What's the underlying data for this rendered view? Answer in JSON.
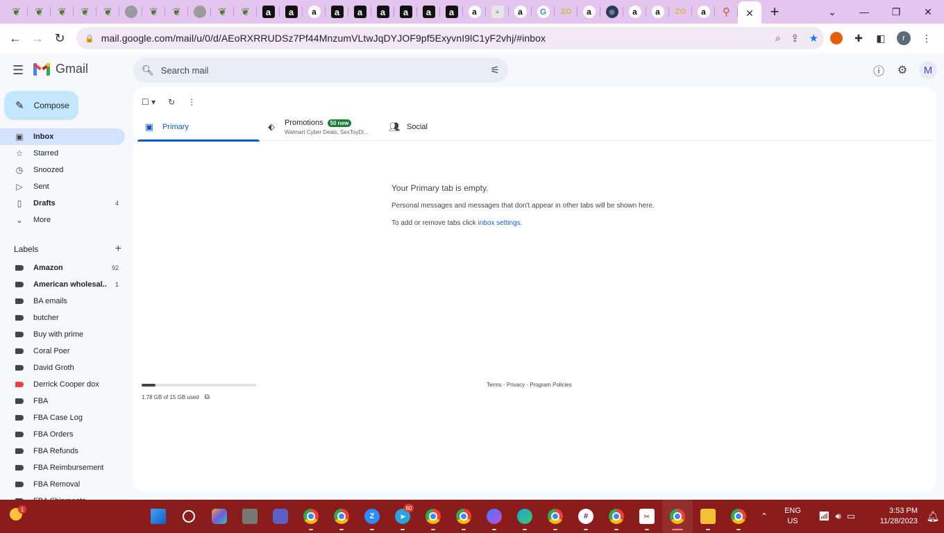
{
  "browser": {
    "tab_favicons": [
      "leaf",
      "leaf",
      "leaf",
      "leaf",
      "leaf",
      "globe",
      "leaf",
      "leaf",
      "globe",
      "leaf",
      "leaf",
      "amazon-a",
      "amazon-a",
      "amazon-smile",
      "amazon-a",
      "amazon-a",
      "amazon-a",
      "amazon-a",
      "amazon-a",
      "amazon-a",
      "amazon-smile",
      "tile",
      "amazon-smile",
      "google",
      "zo",
      "amazon-smile",
      "globe-dark",
      "amazon-smile",
      "amazon-smile",
      "zo",
      "amazon-smile",
      "maps"
    ],
    "active_tab_close": "✕",
    "new_tab": "+",
    "url": "mail.google.com/mail/u/0/d/AEoRXRRUDSz7Pf44MnzumVLtwJqDYJOF9pf5ExyvnI9lC1yF2vhj/#inbox",
    "profile_initial": "r"
  },
  "gmail": {
    "app_name": "Gmail",
    "search_placeholder": "Search mail",
    "account_initial": "M",
    "compose_label": "Compose",
    "nav": [
      {
        "label": "Inbox",
        "icon": "inbox-icon",
        "glyph": "▣",
        "count": "",
        "active": true,
        "bold": true
      },
      {
        "label": "Starred",
        "icon": "star-icon",
        "glyph": "☆",
        "count": "",
        "active": false,
        "bold": false
      },
      {
        "label": "Snoozed",
        "icon": "clock-icon",
        "glyph": "◷",
        "count": "",
        "active": false,
        "bold": false
      },
      {
        "label": "Sent",
        "icon": "send-icon",
        "glyph": "▷",
        "count": "",
        "active": false,
        "bold": false
      },
      {
        "label": "Drafts",
        "icon": "draft-icon",
        "glyph": "▯",
        "count": "4",
        "active": false,
        "bold": true
      },
      {
        "label": "More",
        "icon": "chevron-down-icon",
        "glyph": "⌄",
        "count": "",
        "active": false,
        "bold": false
      }
    ],
    "labels_title": "Labels",
    "labels": [
      {
        "name": "Amazon",
        "count": "92",
        "bold": true,
        "color": "#444444"
      },
      {
        "name": "American wholesal...",
        "count": "1",
        "bold": true,
        "color": "#444444"
      },
      {
        "name": "BA emails",
        "count": "",
        "bold": false,
        "color": "#444444"
      },
      {
        "name": "butcher",
        "count": "",
        "bold": false,
        "color": "#444444"
      },
      {
        "name": "Buy with prime",
        "count": "",
        "bold": false,
        "color": "#444444"
      },
      {
        "name": "Coral Poer",
        "count": "",
        "bold": false,
        "color": "#444444"
      },
      {
        "name": "David Groth",
        "count": "",
        "bold": false,
        "color": "#444444"
      },
      {
        "name": "Derrick Cooper dox",
        "count": "",
        "bold": false,
        "color": "#e8453c"
      },
      {
        "name": "FBA",
        "count": "",
        "bold": false,
        "color": "#444444"
      },
      {
        "name": "FBA Case Log",
        "count": "",
        "bold": false,
        "color": "#444444"
      },
      {
        "name": "FBA Orders",
        "count": "",
        "bold": false,
        "color": "#444444"
      },
      {
        "name": "FBA Refunds",
        "count": "",
        "bold": false,
        "color": "#444444"
      },
      {
        "name": "FBA Reimbursement",
        "count": "",
        "bold": false,
        "color": "#444444"
      },
      {
        "name": "FBA Removal",
        "count": "",
        "bold": false,
        "color": "#444444"
      },
      {
        "name": "FBA Shipments",
        "count": "",
        "bold": false,
        "color": "#444444"
      }
    ],
    "tabs": {
      "primary": "Primary",
      "promotions": "Promotions",
      "promotions_badge": "50 new",
      "promotions_sub": "Walmart Cyber Deals, SexToyDi...",
      "social": "Social"
    },
    "empty": {
      "title": "Your Primary tab is empty.",
      "desc": "Personal messages and messages that don't appear in other tabs will be shown here.",
      "hint_prefix": "To add or remove tabs click ",
      "hint_link": "inbox settings",
      "hint_suffix": "."
    },
    "storage": {
      "text": "1.78 GB of 15 GB used",
      "used_fraction": 0.119
    },
    "footer": "Terms · Privacy · Program Policies",
    "accent_color": "#0b57d0"
  },
  "taskbar": {
    "weather_badge": "1",
    "apps": [
      {
        "name": "start-button",
        "cls": "tb-win",
        "text": "",
        "badge": ""
      },
      {
        "name": "search-button",
        "cls": "tb-search",
        "text": "",
        "badge": ""
      },
      {
        "name": "copilot-app",
        "cls": "tb-copilot",
        "text": "",
        "badge": ""
      },
      {
        "name": "task-view-app",
        "cls": "tb-gray",
        "text": "",
        "badge": ""
      },
      {
        "name": "teams-app",
        "cls": "tb-teams",
        "text": "",
        "badge": ""
      },
      {
        "name": "chrome-app-a",
        "cls": "tb-chrome",
        "text": "",
        "badge": ""
      },
      {
        "name": "chrome-app-b",
        "cls": "tb-chrome",
        "text": "",
        "badge": ""
      },
      {
        "name": "zoom-app",
        "cls": "tb-zoom",
        "text": "Z",
        "badge": ""
      },
      {
        "name": "telegram-app",
        "cls": "tb-tele",
        "text": "➤",
        "badge": "60"
      },
      {
        "name": "chrome-app-c",
        "cls": "tb-chrome",
        "text": "",
        "badge": ""
      },
      {
        "name": "chrome-app-d",
        "cls": "tb-chrome",
        "text": "",
        "badge": ""
      },
      {
        "name": "messenger-app",
        "cls": "tb-msgr",
        "text": "",
        "badge": ""
      },
      {
        "name": "edge-app",
        "cls": "tb-edge",
        "text": "",
        "badge": ""
      },
      {
        "name": "chrome-app-e",
        "cls": "tb-chrome",
        "text": "",
        "badge": ""
      },
      {
        "name": "slack-app",
        "cls": "tb-slack",
        "text": "#",
        "badge": ""
      },
      {
        "name": "chrome-app-f",
        "cls": "tb-chrome",
        "text": "",
        "badge": ""
      },
      {
        "name": "snipping-app",
        "cls": "tb-run",
        "text": "✂",
        "badge": ""
      },
      {
        "name": "chrome-app-g",
        "cls": "tb-chrome",
        "text": "",
        "badge": "",
        "active": true
      },
      {
        "name": "file-explorer-app",
        "cls": "tb-folder",
        "text": "",
        "badge": ""
      },
      {
        "name": "chrome-app-h",
        "cls": "tb-chrome",
        "text": "",
        "badge": ""
      }
    ],
    "lang_line1": "ENG",
    "lang_line2": "US",
    "time": "3:53 PM",
    "date": "11/28/2023"
  }
}
